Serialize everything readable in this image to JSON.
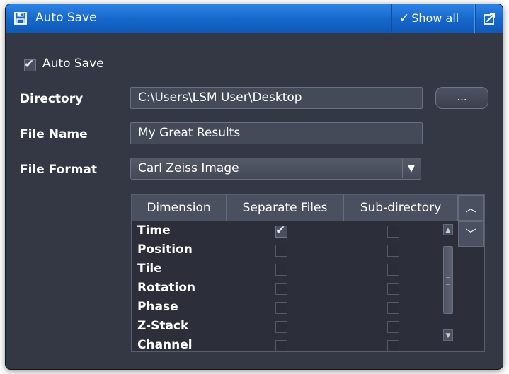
{
  "window": {
    "title": "Auto Save",
    "show_all_label": "Show all"
  },
  "form": {
    "auto_save_label": "Auto Save",
    "auto_save_checked": true,
    "directory_label": "Directory",
    "directory_value": "C:\\Users\\LSM User\\Desktop",
    "browse_label": "...",
    "file_name_label": "File Name",
    "file_name_value": "My Great Results",
    "file_format_label": "File Format",
    "file_format_value": "Carl Zeiss Image"
  },
  "table": {
    "columns": [
      "Dimension",
      "Separate Files",
      "Sub-directory"
    ],
    "rows": [
      {
        "dimension": "Time",
        "separate_files": true,
        "sub_directory": false
      },
      {
        "dimension": "Position",
        "separate_files": false,
        "sub_directory": false
      },
      {
        "dimension": "Tile",
        "separate_files": false,
        "sub_directory": false
      },
      {
        "dimension": "Rotation",
        "separate_files": false,
        "sub_directory": false
      },
      {
        "dimension": "Phase",
        "separate_files": false,
        "sub_directory": false
      },
      {
        "dimension": "Z-Stack",
        "separate_files": false,
        "sub_directory": false
      },
      {
        "dimension": "Channel",
        "separate_files": false,
        "sub_directory": false
      }
    ]
  }
}
